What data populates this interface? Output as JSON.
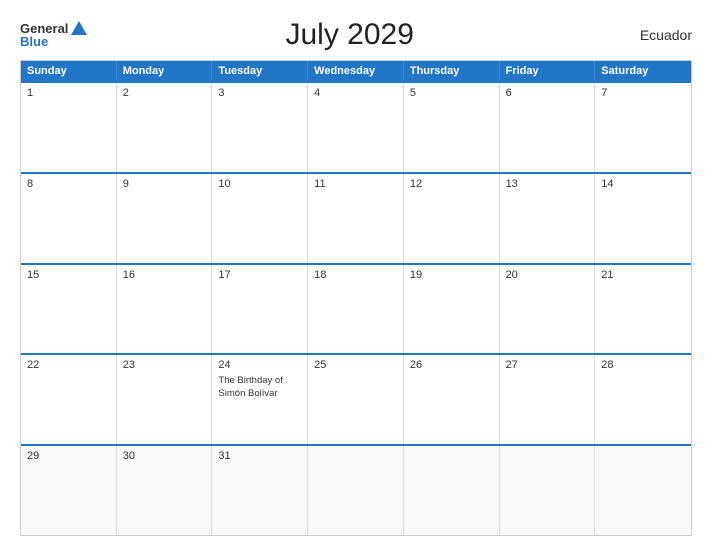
{
  "header": {
    "title": "July 2029",
    "country": "Ecuador",
    "logo_general": "General",
    "logo_blue": "Blue"
  },
  "calendar": {
    "days_of_week": [
      "Sunday",
      "Monday",
      "Tuesday",
      "Wednesday",
      "Thursday",
      "Friday",
      "Saturday"
    ],
    "weeks": [
      [
        {
          "day": "1",
          "event": ""
        },
        {
          "day": "2",
          "event": ""
        },
        {
          "day": "3",
          "event": ""
        },
        {
          "day": "4",
          "event": ""
        },
        {
          "day": "5",
          "event": ""
        },
        {
          "day": "6",
          "event": ""
        },
        {
          "day": "7",
          "event": ""
        }
      ],
      [
        {
          "day": "8",
          "event": ""
        },
        {
          "day": "9",
          "event": ""
        },
        {
          "day": "10",
          "event": ""
        },
        {
          "day": "11",
          "event": ""
        },
        {
          "day": "12",
          "event": ""
        },
        {
          "day": "13",
          "event": ""
        },
        {
          "day": "14",
          "event": ""
        }
      ],
      [
        {
          "day": "15",
          "event": ""
        },
        {
          "day": "16",
          "event": ""
        },
        {
          "day": "17",
          "event": ""
        },
        {
          "day": "18",
          "event": ""
        },
        {
          "day": "19",
          "event": ""
        },
        {
          "day": "20",
          "event": ""
        },
        {
          "day": "21",
          "event": ""
        }
      ],
      [
        {
          "day": "22",
          "event": ""
        },
        {
          "day": "23",
          "event": ""
        },
        {
          "day": "24",
          "event": "The Birthday of Simón Bolívar"
        },
        {
          "day": "25",
          "event": ""
        },
        {
          "day": "26",
          "event": ""
        },
        {
          "day": "27",
          "event": ""
        },
        {
          "day": "28",
          "event": ""
        }
      ],
      [
        {
          "day": "29",
          "event": ""
        },
        {
          "day": "30",
          "event": ""
        },
        {
          "day": "31",
          "event": ""
        },
        {
          "day": "",
          "event": ""
        },
        {
          "day": "",
          "event": ""
        },
        {
          "day": "",
          "event": ""
        },
        {
          "day": "",
          "event": ""
        }
      ]
    ]
  }
}
